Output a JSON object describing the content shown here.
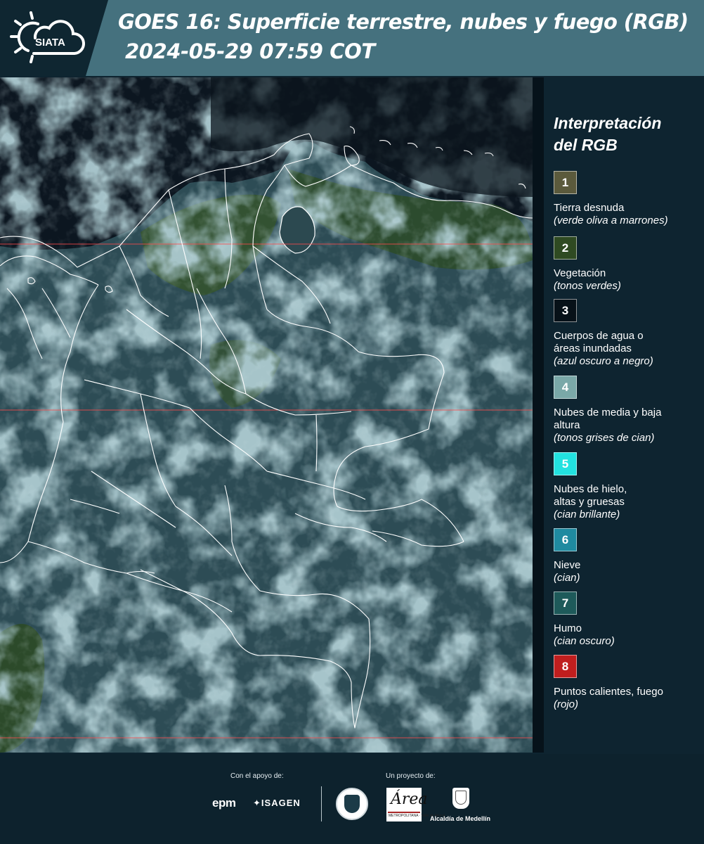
{
  "header": {
    "logo_text": "SIATA",
    "title_line1": "GOES 16: Superficie terrestre, nubes y fuego (RGB)",
    "title_line2": "2024-05-29 07:59 COT"
  },
  "map": {
    "colors": {
      "cloud": "#8fb4bc",
      "vegetation": "#2f4d2a",
      "ocean": "#0c1620",
      "border": "#ffffff",
      "gridline": "#ff4a4a"
    }
  },
  "legend": {
    "title": "Interpretación del RGB",
    "items": [
      {
        "num": "1",
        "color": "#5b5a3c",
        "label": "Tierra desnuda",
        "sub": "(verde oliva a marrones)"
      },
      {
        "num": "2",
        "color": "#2f4a22",
        "label": "Vegetación",
        "sub": "(tonos verdes)"
      },
      {
        "num": "3",
        "color": "#071118",
        "label": "Cuerpos de agua o áreas inundadas",
        "sub": "(azul oscuro a negro)"
      },
      {
        "num": "4",
        "color": "#7aa8a8",
        "label": "Nubes de media y baja altura",
        "sub": "(tonos grises de cian)"
      },
      {
        "num": "5",
        "color": "#22e2e0",
        "label": "Nubes de hielo, altas y gruesas",
        "sub": "(cian brillante)"
      },
      {
        "num": "6",
        "color": "#1f8aa0",
        "label": "Nieve",
        "sub": "(cian)"
      },
      {
        "num": "7",
        "color": "#1e5a5a",
        "label": "Humo",
        "sub": "(cian oscuro)"
      },
      {
        "num": "8",
        "color": "#c01e1e",
        "label": "Puntos calientes, fuego",
        "sub": "(rojo)"
      }
    ]
  },
  "footer": {
    "support_label": "Con el apoyo de:",
    "project_label": "Un proyecto de:",
    "sponsor1": "epm",
    "sponsor2": "ISAGEN",
    "partner1": "Área",
    "partner1_sub": "METROPOLITANA · Valle de Aburrá",
    "partner2": "Alcaldía de Medellín"
  }
}
